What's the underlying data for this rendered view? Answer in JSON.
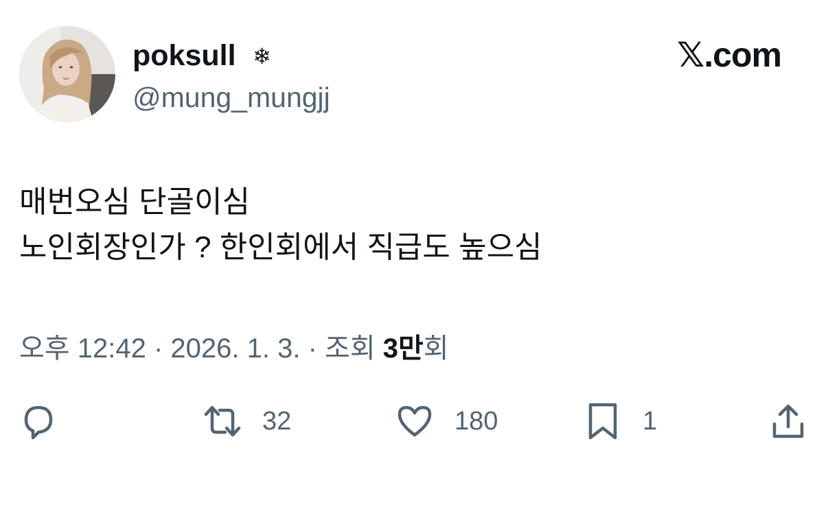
{
  "author": {
    "display_name": "poksull",
    "name_decoration": "❄",
    "handle": "@mung_mungjj"
  },
  "brand": "𝕏.com",
  "tweet": {
    "lines": [
      "매번오심 단골이심",
      "노인회장인가 ? 한인회에서 직급도 높으심"
    ]
  },
  "meta": {
    "time": "오후 12:42",
    "separator": "·",
    "date": "2026. 1. 3.",
    "views_label": "조회",
    "views_count": "3만",
    "views_suffix": "회"
  },
  "actions": {
    "reply": {
      "icon": "reply-icon",
      "count": ""
    },
    "retweet": {
      "icon": "retweet-icon",
      "count": "32"
    },
    "like": {
      "icon": "heart-icon",
      "count": "180"
    },
    "bookmark": {
      "icon": "bookmark-icon",
      "count": "1"
    },
    "share": {
      "icon": "share-icon",
      "count": ""
    }
  },
  "colors": {
    "text_primary": "#0f1419",
    "text_secondary": "#536471",
    "background": "#ffffff"
  }
}
